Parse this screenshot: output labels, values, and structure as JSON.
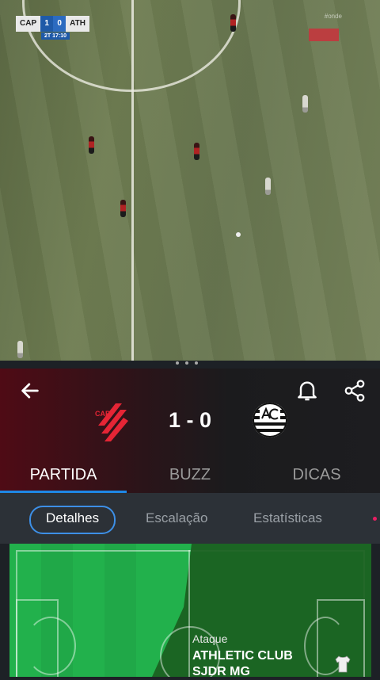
{
  "video": {
    "scorebug": {
      "home": "CAP",
      "home_score": "1",
      "away_score": "0",
      "away": "ATH",
      "period_time": "2T  17:10"
    },
    "broadcast_logo": "#onde",
    "carousel_dots": 3
  },
  "match": {
    "score": "1 - 0",
    "home_team_abbr": "CAP",
    "home_color": "#e52535",
    "away_color": "#ffffff",
    "tabs": [
      "PARTIDA",
      "BUZZ",
      "DICAS"
    ],
    "active_tab": "PARTIDA"
  },
  "sub_tabs": [
    "Detalhes",
    "Escalação",
    "Estatísticas"
  ],
  "active_sub_tab": "Detalhes",
  "field": {
    "label": "Ataque",
    "team": "ATHLETIC CLUB\nSJDR MG"
  },
  "colors": {
    "accent": "#1e88e5",
    "field_green": "#22b14c",
    "field_dark": "#1b5e20",
    "live_dot": "#e91e63"
  }
}
